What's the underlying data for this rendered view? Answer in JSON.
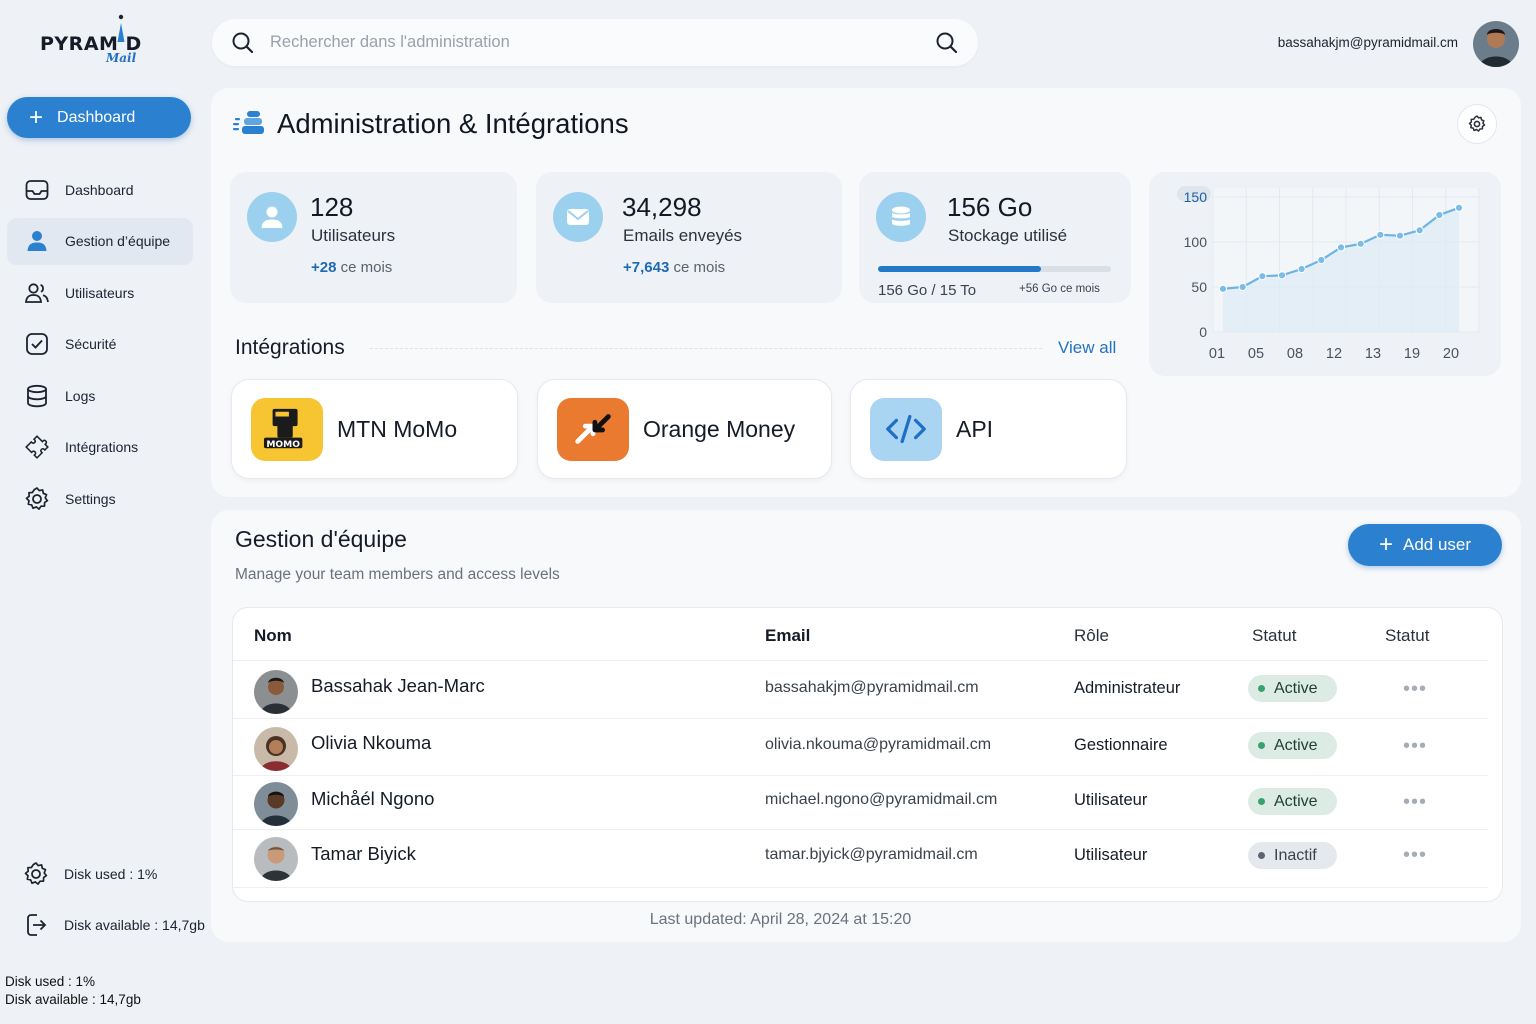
{
  "brand": {
    "name": "PYRAM D",
    "sub": "Mail"
  },
  "sidebar": {
    "primary_button": "Dashboard",
    "items": [
      {
        "label": "Dashboard",
        "icon": "inbox-icon",
        "active": false
      },
      {
        "label": "Gestion d’équipe",
        "icon": "user-icon",
        "active": true
      },
      {
        "label": "Utilisateurs",
        "icon": "users-icon",
        "active": false
      },
      {
        "label": "Sécurité",
        "icon": "shield-check-icon",
        "active": false
      },
      {
        "label": "Logs",
        "icon": "database-icon",
        "active": false
      },
      {
        "label": "Intégrations",
        "icon": "puzzle-icon",
        "active": false
      },
      {
        "label": "Settings",
        "icon": "gear-icon",
        "active": false
      }
    ],
    "disk_used": "Disk used : 1%",
    "disk_available": "Disk available : 14,7gb"
  },
  "footer_note": {
    "disk_used": "Disk used : 1%",
    "disk_available": "Disk available : 14,7gb"
  },
  "search": {
    "placeholder": "Rechercher dans l'administration"
  },
  "user": {
    "email": "bassahakjm@pyramidmail.cm"
  },
  "page": {
    "title": "Administration & Intégrations"
  },
  "stats": {
    "users": {
      "value": "128",
      "label": "Utilisateurs",
      "delta": "+28",
      "delta_suffix": "ce mois"
    },
    "emails": {
      "value": "34,298",
      "label": "Emails enveyés",
      "delta": "+7,643",
      "delta_suffix": "ce mois"
    },
    "storage": {
      "value": "156 Go",
      "label": "Stockage utilisé",
      "used": "156 Go",
      "total": "/ 15 To",
      "delta": "+56",
      "delta_suffix": "Go ce mois",
      "fill_fraction": 0.7
    }
  },
  "chart_data": {
    "type": "line",
    "x": [
      "01",
      "05",
      "08",
      "12",
      "13",
      "19",
      "20"
    ],
    "yticks": [
      "150",
      "100",
      "50",
      "0"
    ],
    "ylim": [
      0,
      160
    ],
    "points": [
      48,
      50,
      62,
      63,
      70,
      80,
      94,
      98,
      108,
      107,
      113,
      130,
      138
    ]
  },
  "integrations": {
    "title": "Intégrations",
    "view_all": "View all",
    "items": [
      {
        "name": "MTN MoMo",
        "color": "#f7c531"
      },
      {
        "name": "Orange Money",
        "color": "#e97a2f"
      },
      {
        "name": "API",
        "color": "#a9d4f2"
      }
    ]
  },
  "team": {
    "title": "Gestion d'équipe",
    "subtitle": "Manage your team members and access levels",
    "add_button": "Add user",
    "columns": [
      "Nom",
      "Email",
      "Rôle",
      "Statut",
      "Statut"
    ],
    "rows": [
      {
        "name": "Bassahak Jean-Marc",
        "email": "bassahakjm@pyramidmail.cm",
        "role": "Administrateur",
        "status": "Active"
      },
      {
        "name": "Olivia Nkouma",
        "email": "olivia.nkouma@pyramidmail.cm",
        "role": "Gestionnaire",
        "status": "Active"
      },
      {
        "name": "Michåél Ngono",
        "email": "michael.ngono@pyramidmail.cm",
        "role": "Utilisateur",
        "status": "Active"
      },
      {
        "name": "Tamar Biyick",
        "email": "tamar.bjyick@pyramidmail.cm",
        "role": "Utilisateur",
        "status": "Inactif"
      }
    ],
    "more": "•••",
    "last_updated": "Last updated: April 28, 2024 at 15:20"
  }
}
